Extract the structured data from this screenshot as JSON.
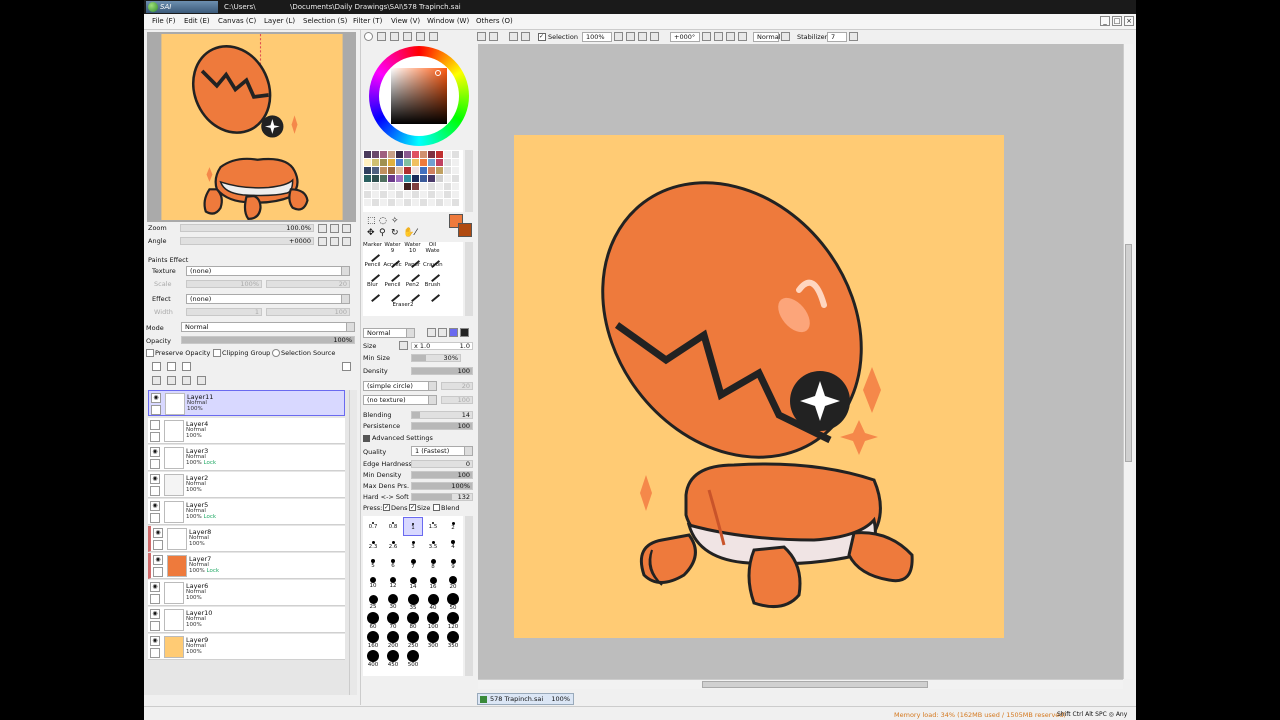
{
  "titlebar": {
    "logo_text": "SAI",
    "path_part1": "C:\\Users\\",
    "path_part2": "\\Documents\\Daily Drawings\\SAI\\578 Trapinch.sai"
  },
  "menu": [
    "File (F)",
    "Edit (E)",
    "Canvas (C)",
    "Layer (L)",
    "Selection (S)",
    "Filter (T)",
    "View (V)",
    "Window (W)",
    "Others (O)"
  ],
  "navigator": {
    "zoom_label": "Zoom",
    "zoom_value": "100.0%",
    "angle_label": "Angle",
    "angle_value": "+0000"
  },
  "paint_effect": {
    "header": "Paints Effect",
    "texture_label": "Texture",
    "texture_value": "(none)",
    "scale_label": "Scale",
    "scale_value": "100%",
    "scale_num": "20",
    "effect_label": "Effect",
    "effect_value": "(none)",
    "width_label": "Width",
    "width_value": "1",
    "width_num": "100"
  },
  "layer_panel": {
    "mode_label": "Mode",
    "mode_value": "Normal",
    "opacity_label": "Opacity",
    "opacity_value": "100%",
    "preserve_opacity": "Preserve Opacity",
    "clipping_group": "Clipping Group",
    "selection_source": "Selection Source",
    "layers": [
      {
        "name": "Layer11",
        "mode": "Normal",
        "opacity": "100%",
        "lock": "",
        "thumb": "#ffffff"
      },
      {
        "name": "Layer4",
        "mode": "Normal",
        "opacity": "100%",
        "lock": "",
        "thumb": "#ffffff"
      },
      {
        "name": "Layer3",
        "mode": "Normal",
        "opacity": "100%",
        "lock": "Lock",
        "thumb": "#ffffff"
      },
      {
        "name": "Layer2",
        "mode": "Normal",
        "opacity": "100%",
        "lock": "",
        "thumb": "#f4f4f4"
      },
      {
        "name": "Layer5",
        "mode": "Normal",
        "opacity": "100%",
        "lock": "Lock",
        "thumb": "#ffffff"
      },
      {
        "name": "Layer8",
        "mode": "Normal",
        "opacity": "100%",
        "lock": "",
        "thumb": "#ffffff"
      },
      {
        "name": "Layer7",
        "mode": "Normal",
        "opacity": "100%",
        "lock": "Lock",
        "thumb": "#ee7a3c"
      },
      {
        "name": "Layer6",
        "mode": "Normal",
        "opacity": "100%",
        "lock": "",
        "thumb": "#ffffff"
      },
      {
        "name": "Layer10",
        "mode": "Normal",
        "opacity": "100%",
        "lock": "",
        "thumb": "#ffffff"
      },
      {
        "name": "Layer9",
        "mode": "Normal",
        "opacity": "100%",
        "lock": "",
        "thumb": "#ffcb74"
      }
    ]
  },
  "tools": {
    "brushes": [
      "Marker",
      "Water",
      "Water",
      "Oil Wate",
      "Pencil",
      "Acrylic",
      "Paper",
      "Crayon",
      "Blur",
      "Pencil",
      "Pen2",
      "Brush",
      "Eraser2"
    ],
    "brush_sub": [
      "",
      "9",
      "10",
      "",
      "",
      "",
      "",
      "",
      "",
      "",
      "",
      "",
      ""
    ],
    "blend_mode": "Normal",
    "size_label": "Size",
    "size_mult": "x 1.0",
    "size_value": "1.0",
    "min_size_label": "Min Size",
    "min_size_value": "30%",
    "density_label": "Density",
    "density_value": "100",
    "shape_value": "(simple circle)",
    "shape_num": "20",
    "texture_value": "(no texture)",
    "texture_num": "100",
    "blending_label": "Blending",
    "blending_value": "14",
    "persistence_label": "Persistence",
    "persistence_value": "100",
    "advanced_label": "Advanced Settings",
    "quality_label": "Quality",
    "quality_value": "1 (Fastest)",
    "edge_label": "Edge Hardness",
    "edge_value": "0",
    "min_density_label": "Min Density",
    "min_density_value": "100",
    "max_dens_label": "Max Dens Prs.",
    "max_dens_value": "100%",
    "hard_soft_label": "Hard <-> Soft",
    "hard_soft_value": "132",
    "press_label": "Press:",
    "press_dens": "Dens",
    "press_size": "Size",
    "press_blend": "Blend",
    "brush_sizes": [
      "0.7",
      "0.8",
      "1",
      "1.5",
      "2",
      "2.3",
      "2.6",
      "3",
      "3.5",
      "4",
      "5",
      "6",
      "7",
      "8",
      "9",
      "10",
      "12",
      "14",
      "16",
      "20",
      "25",
      "30",
      "35",
      "40",
      "50",
      "60",
      "70",
      "80",
      "100",
      "120",
      "160",
      "200",
      "250",
      "300",
      "350",
      "400",
      "450",
      "500"
    ]
  },
  "toolbar": {
    "selection_label": "Selection",
    "zoom_value": "100%",
    "angle_value": "+000°",
    "blend_value": "Normal",
    "stabilizer_label": "Stabilizer",
    "stabilizer_value": "7"
  },
  "canvas": {
    "background": "#ffcb74",
    "body_color": "#ee7a3c"
  },
  "tabs": {
    "file_name": "578 Trapinch.sai",
    "zoom": "100%"
  },
  "statusbar": {
    "memory": "Memory load: 34% (162MB used / 1505MB reserved)",
    "keys": "Shift Ctrl Alt SPC ◎ Any"
  },
  "colors": {
    "accent": "#6a6af0",
    "fg_color": "#ee7a3c",
    "bg_color": "#b04a10"
  }
}
